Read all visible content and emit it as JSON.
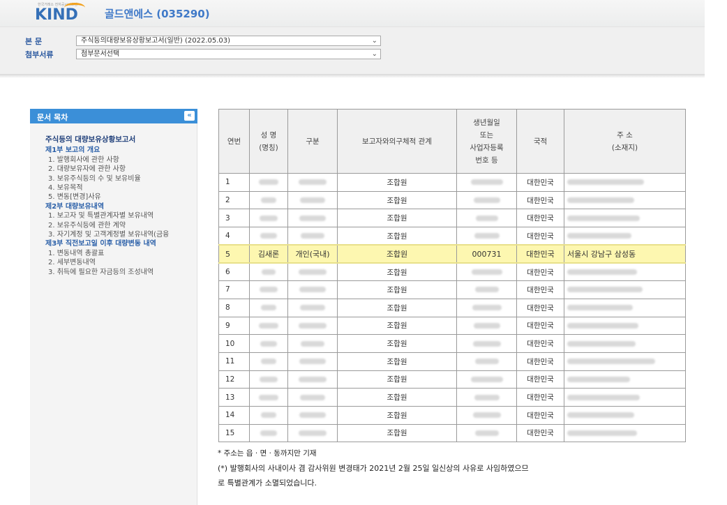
{
  "header": {
    "logo_text": "KIND",
    "logo_tagline": "한국거래소 전자공시시스템",
    "company": "골드앤에스 (035290)"
  },
  "selectors": {
    "body_label": "본 문",
    "body_value": "주식등의대량보유상황보고서(일반) (2022.05.03)",
    "attach_label": "첨부서류",
    "attach_value": "첨부문서선택"
  },
  "sidebar": {
    "title": "문서 목차",
    "collapse_icon": "double-chevron-left-icon",
    "main_title": "주식등의 대량보유상황보고서",
    "parts": [
      {
        "title": "제1부 보고의 개요",
        "items": [
          "1. 발행회사에 관한 사항",
          "2. 대량보유자에 관한 사항",
          "3. 보유주식등의 수 및 보유비율",
          "4. 보유목적",
          "5. 변동[변경]사유"
        ]
      },
      {
        "title": "제2부 대량보유내역",
        "items": [
          "1. 보고자 및 특별관계자별 보유내역",
          "2. 보유주식등에 관한 계약",
          "3. 자기계정 및 고객계정별 보유내역(금융"
        ]
      },
      {
        "title": "제3부 직전보고일 이후 대량변동 내역",
        "items": [
          "1. 변동내역 총괄표",
          "2. 세부변동내역",
          "3. 취득에 필요한 자금등의 조성내역"
        ]
      }
    ]
  },
  "table": {
    "headers": [
      "연번",
      "성 명\n(명칭)",
      "구분",
      "보고자와의구체적 관계",
      "생년월일\n또는\n사업자등록\n번호 등",
      "국적",
      "주 소\n(소재지)"
    ],
    "rows": [
      {
        "no": "1",
        "name": "",
        "type": "",
        "relation": "조합원",
        "id": "",
        "nation": "대한민국",
        "address": ""
      },
      {
        "no": "2",
        "name": "",
        "type": "",
        "relation": "조합원",
        "id": "",
        "nation": "대한민국",
        "address": ""
      },
      {
        "no": "3",
        "name": "",
        "type": "",
        "relation": "조합원",
        "id": "",
        "nation": "대한민국",
        "address": ""
      },
      {
        "no": "4",
        "name": "",
        "type": "",
        "relation": "조합원",
        "id": "",
        "nation": "대한민국",
        "address": ""
      },
      {
        "no": "5",
        "name": "김새론",
        "type": "개인(국내)",
        "relation": "조합원",
        "id": "000731",
        "nation": "대한민국",
        "address": "서울시 강남구 삼성동",
        "highlight": true
      },
      {
        "no": "6",
        "name": "",
        "type": "",
        "relation": "조합원",
        "id": "",
        "nation": "대한민국",
        "address": ""
      },
      {
        "no": "7",
        "name": "",
        "type": "",
        "relation": "조합원",
        "id": "",
        "nation": "대한민국",
        "address": ""
      },
      {
        "no": "8",
        "name": "",
        "type": "",
        "relation": "조합원",
        "id": "",
        "nation": "대한민국",
        "address": ""
      },
      {
        "no": "9",
        "name": "",
        "type": "",
        "relation": "조합원",
        "id": "",
        "nation": "대한민국",
        "address": ""
      },
      {
        "no": "10",
        "name": "",
        "type": "",
        "relation": "조합원",
        "id": "",
        "nation": "대한민국",
        "address": ""
      },
      {
        "no": "11",
        "name": "",
        "type": "",
        "relation": "조합원",
        "id": "",
        "nation": "대한민국",
        "address": ""
      },
      {
        "no": "12",
        "name": "",
        "type": "",
        "relation": "조합원",
        "id": "",
        "nation": "대한민국",
        "address": ""
      },
      {
        "no": "13",
        "name": "",
        "type": "",
        "relation": "조합원",
        "id": "",
        "nation": "대한민국",
        "address": ""
      },
      {
        "no": "14",
        "name": "",
        "type": "",
        "relation": "조합원",
        "id": "",
        "nation": "대한민국",
        "address": ""
      },
      {
        "no": "15",
        "name": "",
        "type": "",
        "relation": "조합원",
        "id": "",
        "nation": "대한민국",
        "address": ""
      }
    ]
  },
  "notes": {
    "note1": "* 주소는 읍 · 면 · 동까지만 기재",
    "note2a": "(*) 발행회사의 사내이사 겸 감사위원 변경태가 2021년 2월 25일 일신상의 사유로 사임하였으므",
    "note2b": "로 특별관계가 소멸되었습니다."
  },
  "colors": {
    "accent": "#3b8fd8",
    "highlight": "#fdf7b0",
    "company": "#3f79c8"
  }
}
